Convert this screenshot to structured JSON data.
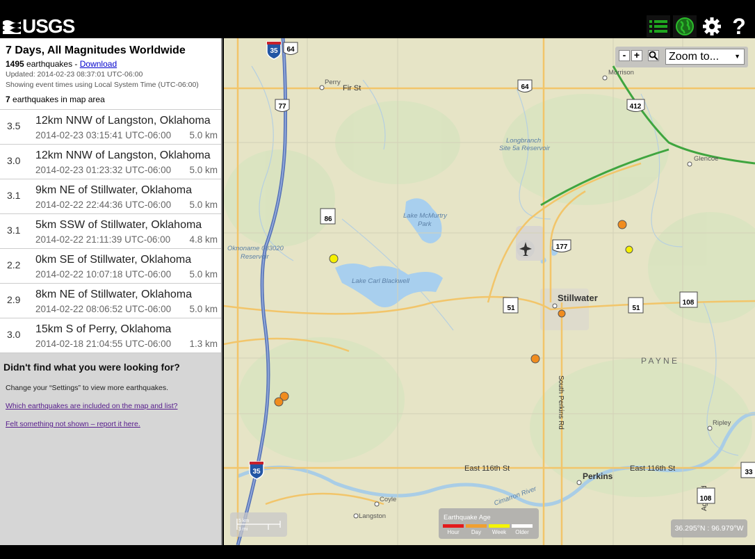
{
  "header": {
    "logo_text": "USGS",
    "icons": [
      "list-icon",
      "globe-icon",
      "gear-icon",
      "help-icon"
    ],
    "help_glyph": "?"
  },
  "summary": {
    "title": "7 Days, All Magnitudes Worldwide",
    "count": "1495",
    "count_suffix": " earthquakes - ",
    "download_label": "Download",
    "updated": "Updated: 2014-02-23 08:37:01 UTC-06:00",
    "timezone_note": "Showing event times using Local System Time (UTC-06:00)",
    "in_area_count": "7",
    "in_area_suffix": " earthquakes in map area"
  },
  "events": [
    {
      "mag": "3.5",
      "place": "12km NNW of Langston, Oklahoma",
      "time": "2014-02-23 03:15:41 UTC-06:00",
      "depth": "5.0 km"
    },
    {
      "mag": "3.0",
      "place": "12km NNW of Langston, Oklahoma",
      "time": "2014-02-23 01:23:32 UTC-06:00",
      "depth": "5.0 km"
    },
    {
      "mag": "3.1",
      "place": "9km NE of Stillwater, Oklahoma",
      "time": "2014-02-22 22:44:36 UTC-06:00",
      "depth": "5.0 km"
    },
    {
      "mag": "3.1",
      "place": "5km SSW of Stillwater, Oklahoma",
      "time": "2014-02-22 21:11:39 UTC-06:00",
      "depth": "4.8 km"
    },
    {
      "mag": "2.2",
      "place": "0km SE of Stillwater, Oklahoma",
      "time": "2014-02-22 10:07:18 UTC-06:00",
      "depth": "5.0 km"
    },
    {
      "mag": "2.9",
      "place": "8km NE of Stillwater, Oklahoma",
      "time": "2014-02-22 08:06:52 UTC-06:00",
      "depth": "5.0 km"
    },
    {
      "mag": "3.0",
      "place": "15km S of Perry, Oklahoma",
      "time": "2014-02-18 21:04:55 UTC-06:00",
      "depth": "1.3 km"
    }
  ],
  "help": {
    "heading": "Didn't find what you were looking for?",
    "settings_note": "Change your “Settings” to view more earthquakes.",
    "link_included": "Which earthquakes are included on the map and list?",
    "link_report": "Felt something not shown – report it here."
  },
  "map": {
    "zoom_out": "-",
    "zoom_in": "+",
    "zoom_select": "Zoom to...",
    "labels": {
      "perry": "Perry",
      "fir_st": "Fir St",
      "morrison": "Morrison",
      "glencoe": "Glencoe",
      "longbranch_1": "Longbranch",
      "longbranch_2": "Site 5a Reservoir",
      "mcmurtry_1": "Lake McMurtry",
      "mcmurtry_2": "Park",
      "oknoname_1": "Oknoname 083020",
      "oknoname_2": "Reservoir",
      "carl_blackwell": "Lake Carl Blackwell",
      "stillwater": "Stillwater",
      "payne": "P A Y N E",
      "south_perkins": "South Perkins Rd",
      "ripley": "Ripley",
      "east_116_west": "East 116th St",
      "east_116_east": "East 116th St",
      "perkins": "Perkins",
      "coyle": "Coyle",
      "langston": "Langston",
      "cimarron": "Cimarron River",
      "agra": "Agra Rd"
    },
    "shields": {
      "i35_top": "35",
      "us64_top": "64",
      "us64_mid": "64",
      "us77": "77",
      "us412": "412",
      "sh86": "86",
      "us177": "177",
      "sh51_w": "51",
      "sh51_e": "51",
      "sh108_n": "108",
      "i35_bottom": "35",
      "sh108_s": "108",
      "sh33": "33"
    },
    "scale": {
      "km": "5 km",
      "mi": "3 mi"
    },
    "legend": {
      "title": "Earthquake Age",
      "items": [
        {
          "label": "Hour",
          "color": "#e31a1c"
        },
        {
          "label": "Day",
          "color": "#f0a030"
        },
        {
          "label": "Week",
          "color": "#f5f500"
        },
        {
          "label": "Older",
          "color": "#ffffff"
        }
      ]
    },
    "coords": "36.295°N : 96.979°W",
    "colors": {
      "day": "#f08c1e",
      "week": "#f5f000"
    }
  }
}
